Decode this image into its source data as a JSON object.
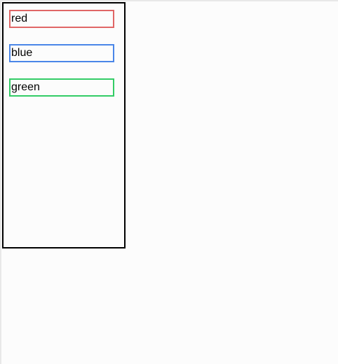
{
  "colors": {
    "red": "#e06666",
    "blue": "#4a86e8",
    "green": "#33cc66"
  },
  "panel": {
    "items": [
      {
        "label": "red"
      },
      {
        "label": "blue"
      },
      {
        "label": "green"
      }
    ]
  }
}
